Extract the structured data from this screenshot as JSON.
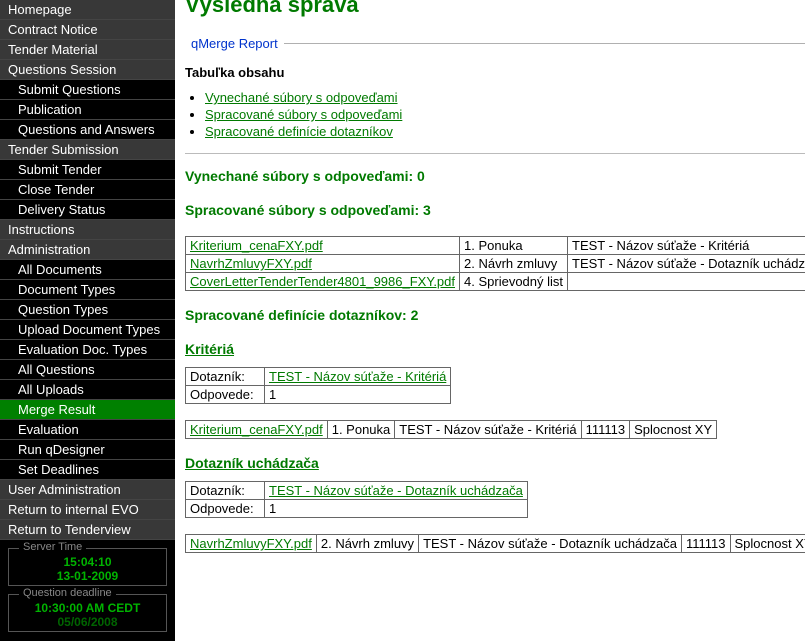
{
  "sidebar": {
    "items": [
      {
        "label": "Homepage",
        "type": "section"
      },
      {
        "label": "Contract Notice",
        "type": "section"
      },
      {
        "label": "Tender Material",
        "type": "section"
      },
      {
        "label": "Questions Session",
        "type": "section"
      },
      {
        "label": "Submit Questions",
        "type": "item"
      },
      {
        "label": "Publication",
        "type": "item"
      },
      {
        "label": "Questions and Answers",
        "type": "item"
      },
      {
        "label": "Tender Submission",
        "type": "section"
      },
      {
        "label": "Submit Tender",
        "type": "item"
      },
      {
        "label": "Close Tender",
        "type": "item"
      },
      {
        "label": "Delivery Status",
        "type": "item"
      },
      {
        "label": "Instructions",
        "type": "section"
      },
      {
        "label": "Administration",
        "type": "section"
      },
      {
        "label": "All Documents",
        "type": "item"
      },
      {
        "label": "Document Types",
        "type": "item"
      },
      {
        "label": "Question Types",
        "type": "item"
      },
      {
        "label": "Upload Document Types",
        "type": "item"
      },
      {
        "label": "Evaluation Doc. Types",
        "type": "item"
      },
      {
        "label": "All Questions",
        "type": "item"
      },
      {
        "label": "All Uploads",
        "type": "item"
      },
      {
        "label": "Merge Result",
        "type": "item",
        "active": true
      },
      {
        "label": "Evaluation",
        "type": "item"
      },
      {
        "label": "Run qDesigner",
        "type": "item"
      },
      {
        "label": "Set Deadlines",
        "type": "item"
      },
      {
        "label": "User Administration",
        "type": "section"
      },
      {
        "label": "Return to internal EVO",
        "type": "section"
      },
      {
        "label": "Return to Tenderview",
        "type": "section"
      }
    ],
    "server_box": {
      "legend": "Server Time",
      "l1": "15:04:10",
      "l2": "13-01-2009"
    },
    "deadline_box": {
      "legend": "Question deadline",
      "l1": "10:30:00 AM CEDT",
      "l2": "05/06/2008"
    }
  },
  "main": {
    "title": "Výsledná správa",
    "report_legend": "qMerge Report",
    "toc_title": "Tabuľka obsahu",
    "toc": [
      "Vynechané súbory s odpoveďami",
      "Spracované súbory s odpoveďami",
      "Spracované definície dotazníkov"
    ],
    "h_skipped": "Vynechané súbory s odpoveďami: 0",
    "h_processed": "Spracované súbory s odpoveďami: 3",
    "files": [
      {
        "file": "Kriterium_cenaFXY.pdf",
        "c2": "1. Ponuka",
        "c3": "TEST - Názov súťaže - Kritériá"
      },
      {
        "file": "NavrhZmluvyFXY.pdf",
        "c2": "2. Návrh zmluvy",
        "c3": "TEST - Názov súťaže - Dotazník uchádzača"
      },
      {
        "file": "CoverLetterTenderTender4801_9986_FXY.pdf",
        "c2": "4. Sprievodný list",
        "c3": ""
      }
    ],
    "h_defs": "Spracované definície dotazníkov: 2",
    "kriteria": {
      "title": "Kritériá",
      "kv": {
        "k1": "Dotazník:",
        "v1": "TEST - Názov súťaže - Kritériá",
        "k2": "Odpovede:",
        "v2": "1"
      },
      "row": {
        "file": "Kriterium_cenaFXY.pdf",
        "c2": "1. Ponuka",
        "c3": "TEST - Názov súťaže - Kritériá",
        "c4": "111113",
        "c5": "Splocnost XY"
      }
    },
    "dotaznik": {
      "title": "Dotazník uchádzača",
      "kv": {
        "k1": "Dotazník:",
        "v1": "TEST - Názov súťaže - Dotazník uchádzača",
        "k2": "Odpovede:",
        "v2": "1"
      },
      "row": {
        "file": "NavrhZmluvyFXY.pdf",
        "c2": "2. Návrh zmluvy",
        "c3": "TEST - Názov súťaže - Dotazník uchádzača",
        "c4": "111113",
        "c5": "Splocnost XY"
      }
    }
  }
}
